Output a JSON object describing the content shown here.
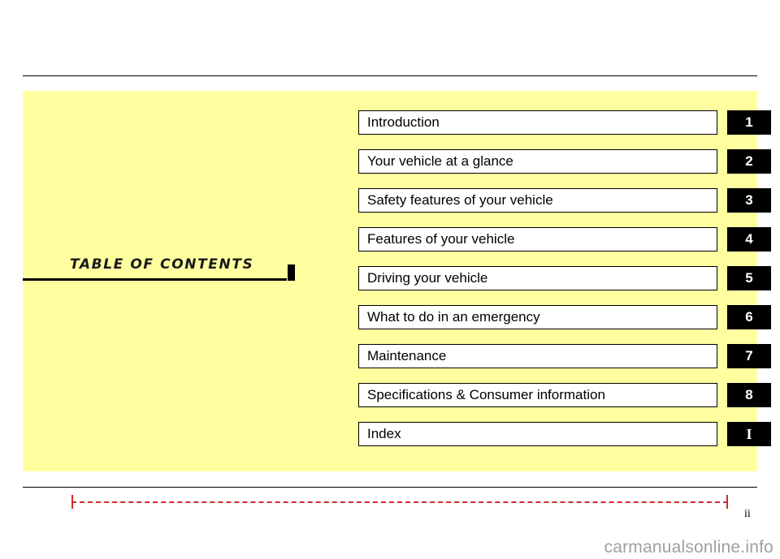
{
  "document": {
    "heading": "TABLE  OF  CONTENTS",
    "page_number": "ii",
    "watermark": "carmanualsonline.info",
    "colors": {
      "panel": "#ffffa0",
      "tab": "#000000",
      "footer_line": "#cf2b2b"
    }
  },
  "contents": [
    {
      "label": "Introduction",
      "tab": "1"
    },
    {
      "label": "Your vehicle at a glance",
      "tab": "2"
    },
    {
      "label": "Safety features of your vehicle",
      "tab": "3"
    },
    {
      "label": "Features of your vehicle",
      "tab": "4"
    },
    {
      "label": "Driving your vehicle",
      "tab": "5"
    },
    {
      "label": "What to do in an emergency",
      "tab": "6"
    },
    {
      "label": "Maintenance",
      "tab": "7"
    },
    {
      "label": "Specifications & Consumer information",
      "tab": "8"
    },
    {
      "label": "Index",
      "tab": "I"
    }
  ]
}
